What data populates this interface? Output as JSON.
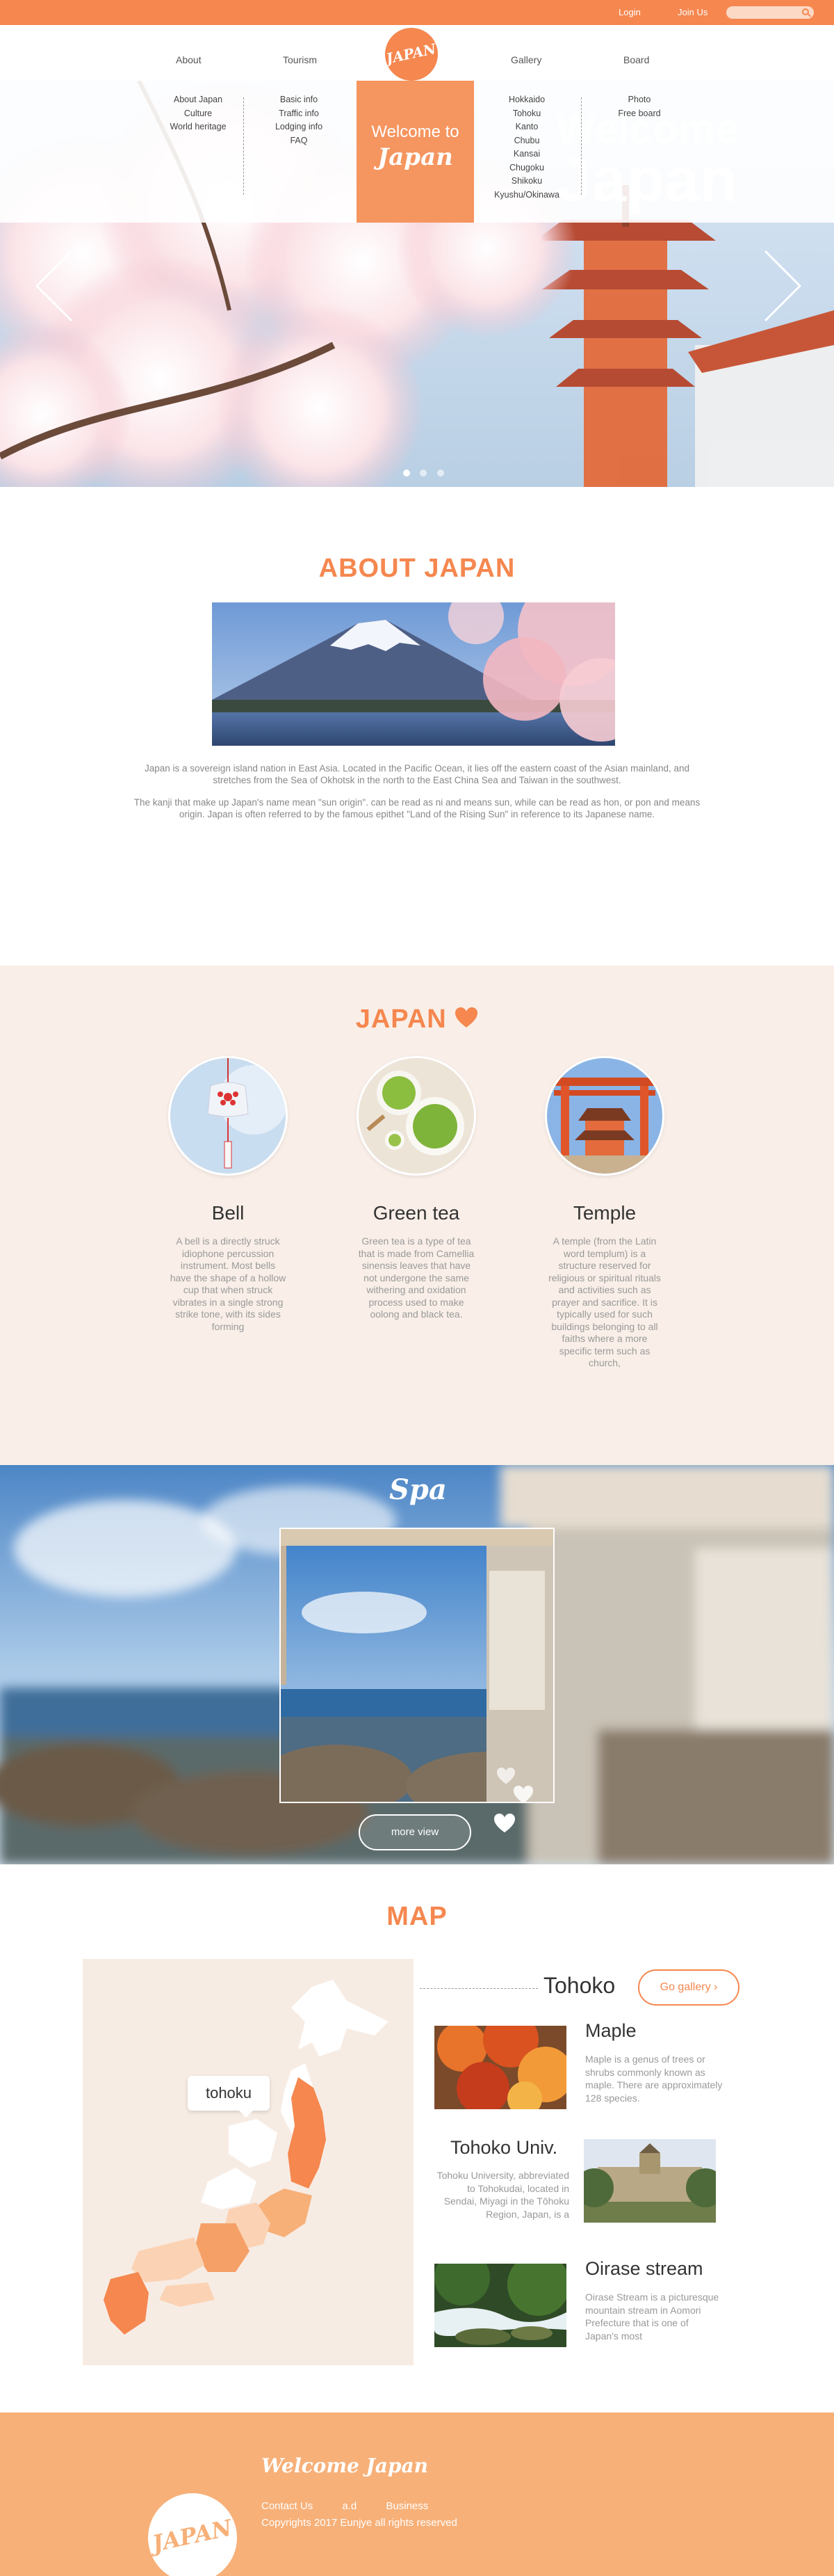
{
  "topbar": {
    "login": "Login",
    "join": "Join Us"
  },
  "nav": {
    "about": "About",
    "tourism": "Tourism",
    "gallery": "Gallery",
    "board": "Board",
    "logo_text": "JAPAN"
  },
  "dropdown": {
    "about_items": [
      "About Japan",
      "Culture",
      "World heritage"
    ],
    "tourism_items": [
      "Basic info",
      "Traffic info",
      "Lodging info",
      "FAQ"
    ],
    "region_items": [
      "Hokkaido",
      "Tohoku",
      "Kanto",
      "Chubu",
      "Kansai",
      "Chugoku",
      "Shikoku",
      "Kyushu/Okinawa"
    ],
    "board_items": [
      "Photo",
      "Free board"
    ],
    "welcome_line1": "Welcome to",
    "welcome_line2": "Japan",
    "ghost_line1": "Welcome",
    "ghost_line2": "Japan"
  },
  "about": {
    "title": "ABOUT JAPAN",
    "para1": "Japan is a sovereign island nation in East Asia. Located in the Pacific Ocean, it lies off the eastern coast of the Asian mainland, and stretches from the Sea of Okhotsk in the north to the East China Sea and Taiwan in the southwest.",
    "para2": "The kanji that make up Japan's name mean \"sun origin\".       can be read as ni and means sun, while      can be read as hon, or pon and means origin. Japan is often referred to by the famous epithet \"Land of the Rising Sun\" in reference to its Japanese name."
  },
  "love": {
    "title": "JAPAN",
    "cards": [
      {
        "title": "Bell",
        "text": "A bell is a directly struck idiophone percussion instrument. Most bells have the shape of a hollow cup that when struck vibrates in a single strong strike tone, with its sides forming"
      },
      {
        "title": "Green tea",
        "text": "Green tea is a type of tea that is made from Camellia sinensis leaves that have not undergone the same withering and oxidation process used to make oolong and black tea."
      },
      {
        "title": "Temple",
        "text": "A temple (from the Latin word templum) is a structure reserved for religious or spiritual rituals and activities such as prayer and sacrifice. It is typically used for such buildings belonging to all faiths where a more specific term such as church,"
      }
    ]
  },
  "spa": {
    "title": "Spa",
    "button": "more view"
  },
  "map": {
    "title": "MAP",
    "tooltip": "tohoku",
    "region": "Tohoko",
    "gallery_button": "Go gallery",
    "spots": [
      {
        "title": "Maple",
        "text": "Maple is a genus of trees or shrubs commonly known as maple. There are approximately 128 species."
      },
      {
        "title": "Tohoko Univ.",
        "text": "Tohoku University, abbreviated to Tohokudai, located in Sendai, Miyagi in the Tōhoku Region, Japan, is a"
      },
      {
        "title": "Oirase stream",
        "text": "Oirase Stream is a picturesque mountain stream in Aomori Prefecture that is one of Japan's most"
      }
    ]
  },
  "footer": {
    "welcome": "Welcome Japan",
    "links": [
      "Contact Us",
      "a.d",
      "Business"
    ],
    "copyright": "Copyrights 2017 Eunjye all rights reserved"
  },
  "colors": {
    "accent": "#f5874f",
    "light_accent": "#f7b078",
    "cream": "#f9efe8"
  }
}
